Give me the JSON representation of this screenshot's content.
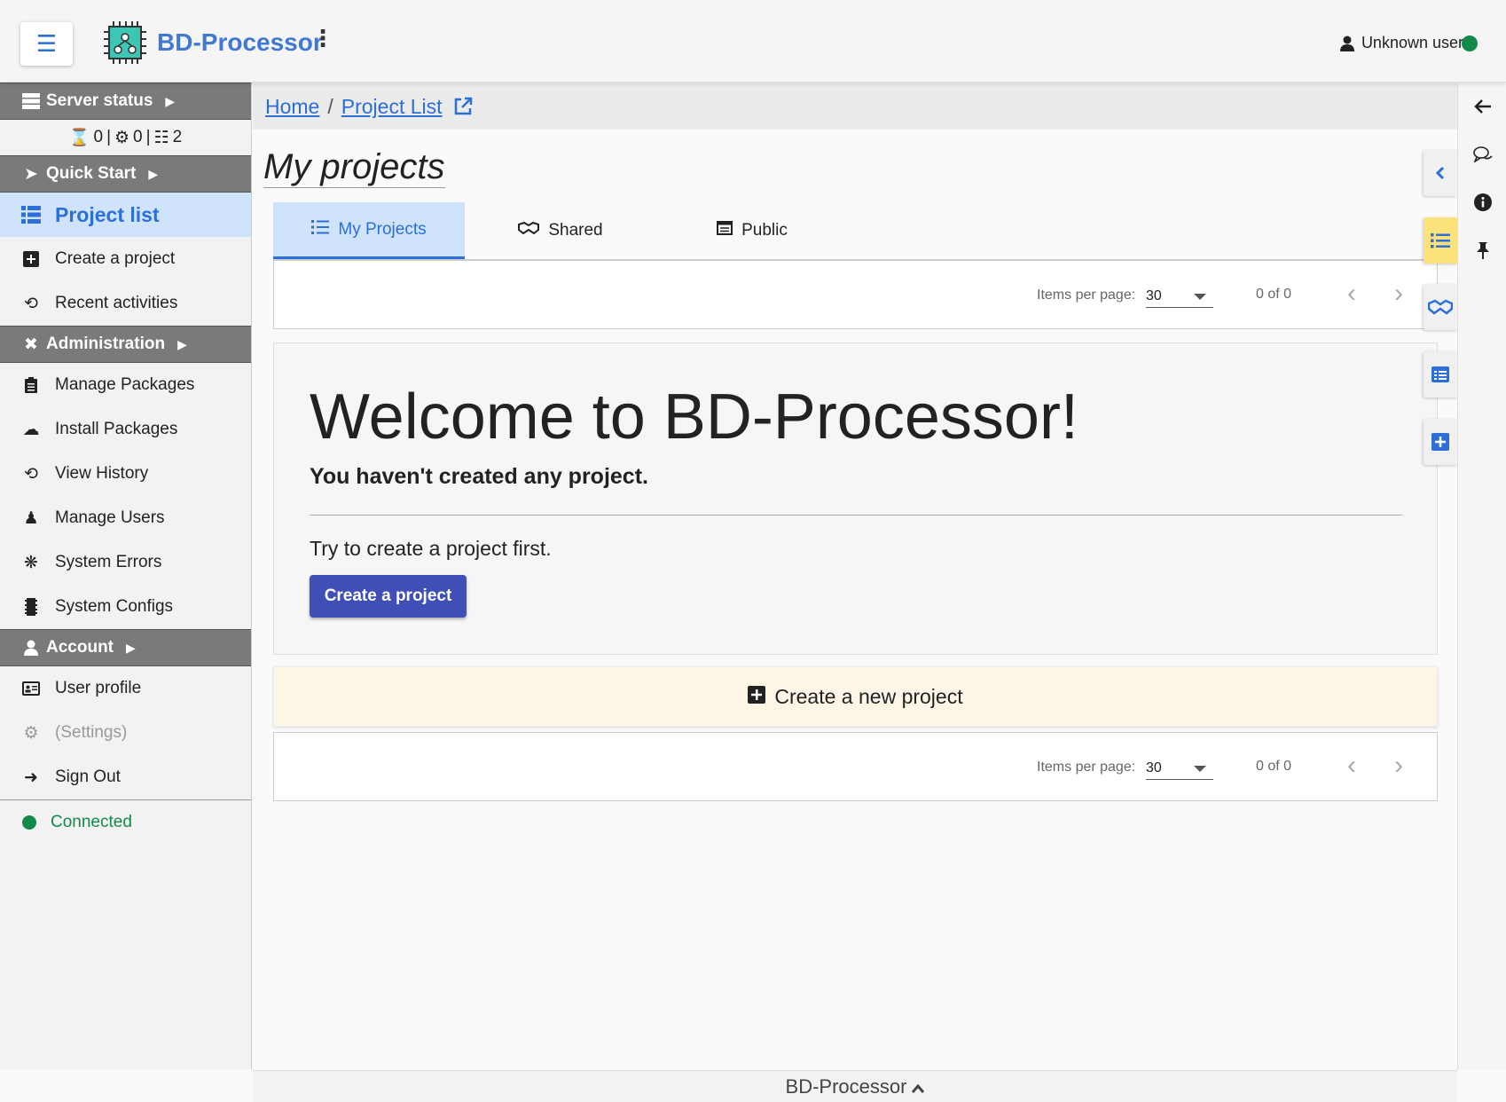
{
  "header": {
    "app_title": "BD-Processor",
    "user_name": "Unknown user",
    "status_color": "#128a4a"
  },
  "sidebar": {
    "server_status": {
      "label": "Server status",
      "counts": {
        "pending": "0",
        "running": "0",
        "nodes": "2"
      }
    },
    "quick_start_label": "Quick Start",
    "quick_start_items": [
      {
        "label": "Project list",
        "icon": "list-icon",
        "active": true
      },
      {
        "label": "Create a project",
        "icon": "plus-square-icon"
      },
      {
        "label": "Recent activities",
        "icon": "history-icon"
      }
    ],
    "administration_label": "Administration",
    "administration_items": [
      {
        "label": "Manage Packages",
        "icon": "clipboard-icon"
      },
      {
        "label": "Install Packages",
        "icon": "cloud-download-icon"
      },
      {
        "label": "View History",
        "icon": "history-icon"
      },
      {
        "label": "Manage Users",
        "icon": "users-cog-icon"
      },
      {
        "label": "System Errors",
        "icon": "bug-icon"
      },
      {
        "label": "System Configs",
        "icon": "memory-icon"
      }
    ],
    "account_label": "Account",
    "account_items": [
      {
        "label": "User profile",
        "icon": "id-card-icon"
      },
      {
        "label": "(Settings)",
        "icon": "gears-icon",
        "disabled": true
      },
      {
        "label": "Sign Out",
        "icon": "sign-out-icon"
      }
    ],
    "connection_status": "Connected"
  },
  "breadcrumb": {
    "home": "Home",
    "separator": "/",
    "current": "Project List"
  },
  "main": {
    "page_title": "My projects",
    "tabs": [
      {
        "label": "My Projects",
        "icon": "list-icon",
        "active": true
      },
      {
        "label": "Shared",
        "icon": "handshake-icon"
      },
      {
        "label": "Public",
        "icon": "table-icon"
      }
    ],
    "pager": {
      "items_per_page_label": "Items per page:",
      "items_per_page_value": "30",
      "range_label": "0 of 0"
    },
    "welcome": {
      "heading": "Welcome to BD-Processor!",
      "subheading": "You haven't created any project.",
      "hint": "Try to create a project first.",
      "button_label": "Create a project"
    },
    "create_new_label": "Create a new project"
  },
  "footer": {
    "label": "BD-Processor"
  },
  "colors": {
    "accent": "#2c6fd6",
    "primary_button": "#3f4fb7",
    "section_header": "#7a7a7a",
    "active_bg": "#cfe3fb",
    "highlight": "#fbe27a",
    "new_project_bg": "#fdf5e6"
  }
}
